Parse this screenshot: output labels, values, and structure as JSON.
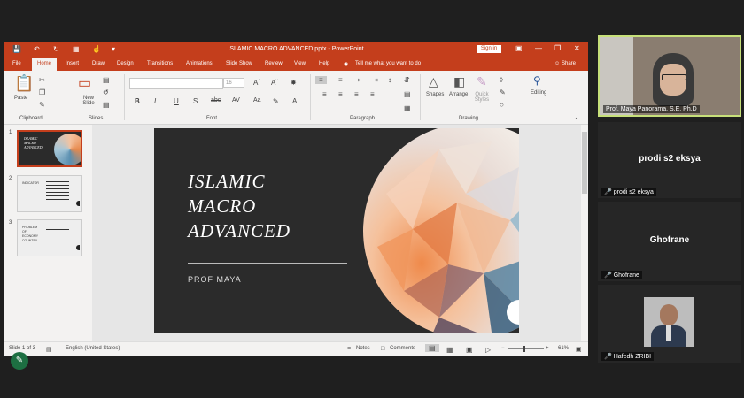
{
  "titlebar": {
    "document_title": "ISLAMIC MACRO ADVANCED.pptx - PowerPoint",
    "sign_in": "Sign in"
  },
  "tabs": [
    "File",
    "Home",
    "Insert",
    "Draw",
    "Design",
    "Transitions",
    "Animations",
    "Slide Show",
    "Review",
    "View",
    "Help"
  ],
  "active_tab": "Home",
  "tell_me": "Tell me what you want to do",
  "share": "Share",
  "ribbon": {
    "paste": "Paste",
    "new_slide": "New Slide",
    "font_size": "16",
    "shapes": "Shapes",
    "arrange": "Arrange",
    "quick_styles": "Quick Styles",
    "editing": "Editing",
    "groups": {
      "clipboard": "Clipboard",
      "slides": "Slides",
      "font": "Font",
      "paragraph": "Paragraph",
      "drawing": "Drawing"
    }
  },
  "thumbnails": [
    {
      "num": "1",
      "lines": [
        "ISLAMIC",
        "MACRO",
        "ADVANCED"
      ]
    },
    {
      "num": "2",
      "lines": [
        "INDICATOR"
      ]
    },
    {
      "num": "3",
      "lines": [
        "PROBLEM",
        "OF",
        "ECONOMY",
        "COUNTRY"
      ]
    }
  ],
  "slide": {
    "title_lines": [
      "ISLAMIC",
      "MACRO",
      "ADVANCED"
    ],
    "subtitle": "PROF MAYA"
  },
  "status": {
    "slide_info": "Slide 1 of 3",
    "language": "English (United States)",
    "notes": "Notes",
    "comments": "Comments",
    "zoom": "61%"
  },
  "participants": [
    {
      "name": "Prof. Maya Panorama, S.E, Ph.D"
    },
    {
      "name": "prodi s2 eksya",
      "center": "prodi s2 eksya"
    },
    {
      "name": "Ghofrane",
      "center": "Ghofrane"
    },
    {
      "name": "Hafedh ZRIBI"
    }
  ]
}
